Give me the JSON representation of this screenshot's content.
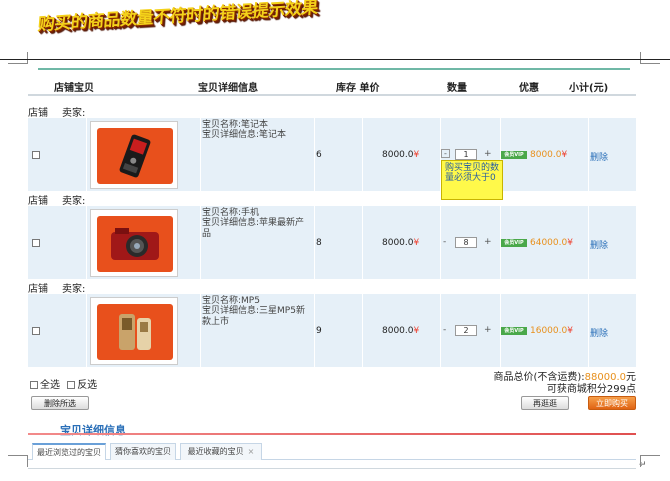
{
  "banner": {
    "text": "购买的商品数量不符时的错误提示效果"
  },
  "header": {
    "shop_item": "店铺宝贝",
    "detail": "宝贝详细信息",
    "stock_price": "库存 单价",
    "quantity": "数量",
    "discount": "优惠",
    "subtotal": "小计(元)"
  },
  "shop_labels": {
    "shop": "店铺",
    "seller": "卖家:"
  },
  "items": [
    {
      "name": "宝贝名称:笔记本",
      "detail": "宝贝详细信息:笔记本",
      "stock": "6",
      "price": "8000.0",
      "currency": "¥",
      "minus": "-",
      "qty": "1",
      "plus": "+",
      "vip": "会员VIP",
      "vip_price": "8000.0",
      "delete": "删除",
      "icon": "phone-icon"
    },
    {
      "name": "宝贝名称:手机",
      "detail": "宝贝详细信息:苹果最新产品",
      "stock": "8",
      "price": "8000.0",
      "currency": "¥",
      "minus": "-",
      "qty": "8",
      "plus": "+",
      "vip": "会员VIP",
      "vip_price": "64000.0",
      "delete": "删除",
      "icon": "camera-icon"
    },
    {
      "name": "宝贝名称:MP5",
      "detail": "宝贝详细信息:三星MP5新款上市",
      "stock": "9",
      "price": "8000.0",
      "currency": "¥",
      "minus": "-",
      "qty": "2",
      "plus": "+",
      "vip": "会员VIP",
      "vip_price": "16000.0",
      "delete": "删除",
      "icon": "mp5-player-icon"
    }
  ],
  "tooltip": {
    "text": "购买宝贝的数量必须大于0"
  },
  "footer": {
    "select_all": "全选",
    "invert_select": "反选",
    "total_label": "商品总价(不含运费):",
    "total_value": "88000.0",
    "total_unit": "元",
    "points": "可获商城积分299点",
    "delete_selected": "删除所选",
    "continue_shopping": "再逛逛",
    "buy_now": "立即购买"
  },
  "section": {
    "title": "宝贝详细信息"
  },
  "tabs": [
    {
      "label": "最近浏览过的宝贝"
    },
    {
      "label": "猜你喜欢的宝贝"
    },
    {
      "label": "最近收藏的宝贝"
    }
  ],
  "tab_close": "×",
  "cursor_mark": "↵",
  "colors": {
    "accent_blue": "#2a6fb8",
    "row_bg": "#e6f0f8",
    "product_bg": "#e8501c",
    "vip_green": "#4aa84a",
    "price_orange": "#e8901c",
    "tooltip_yellow": "#fff94a"
  }
}
